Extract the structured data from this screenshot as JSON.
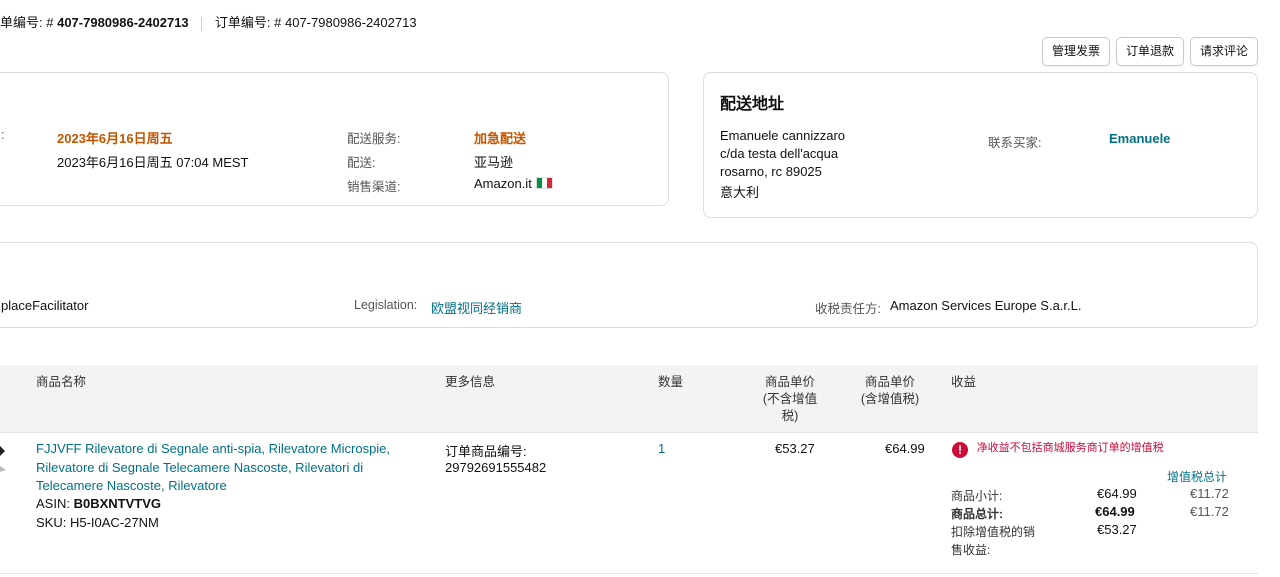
{
  "header": {
    "order_label_1": "单编号: #",
    "order_number_1": "407-7980986-2402713",
    "order_label_2": "订单编号: # 407-7980986-2402713"
  },
  "actions": {
    "manage_invoice": "管理发票",
    "refund": "订单退款",
    "request_review": "请求评论"
  },
  "order_card": {
    "colon": ":",
    "ship_by_date": "2023年6月16日周五",
    "purchase_date": "2023年6月16日周五 07:04 MEST",
    "shipping_service_label": "配送服务:",
    "shipping_service_value": "加急配送",
    "fulfillment_label": "配送:",
    "fulfillment_value": "亚马逊",
    "sales_channel_label": "销售渠道:",
    "sales_channel_value": "Amazon.it"
  },
  "shipping_card": {
    "title": "配送地址",
    "address_lines": [
      "Emanuele cannizzaro",
      "c/da testa dell'acqua",
      "rosarno, rc 89025",
      "意大利"
    ],
    "contact_label": "联系买家:",
    "contact_name": "Emanuele"
  },
  "tax_card": {
    "facilitator": "placeFacilitator",
    "legislation_label": "Legislation:",
    "legislation_value": "欧盟视同经销商",
    "tax_party_label": "收税责任方:",
    "tax_party_value": "Amazon Services Europe S.a.r.L."
  },
  "table": {
    "headers": {
      "product_name": "商品名称",
      "more_info": "更多信息",
      "quantity": "数量",
      "price_ex_vat_line1": "商品单价",
      "price_ex_vat_line2": "(不含增值",
      "price_ex_vat_line3": "税)",
      "price_inc_vat_line1": "商品单价",
      "price_inc_vat_line2": "(含增值税)",
      "proceeds": "收益"
    },
    "row": {
      "title": "FJJVFF Rilevatore di Segnale anti-spia, Rilevatore Microspie, Rilevatore di Segnale Telecamere Nascoste, Rilevatori di Telecamere Nascoste, Rilevatore",
      "asin_label": "ASIN:",
      "asin": "B0BXNTVTVG",
      "sku_label": "SKU:",
      "sku": "H5-I0AC-27NM",
      "order_item_label": "订单商品编号:",
      "order_item_id": "29792691555482",
      "quantity": "1",
      "price_ex_vat": "€53.27",
      "price_inc_vat": "€64.99",
      "warning": "净收益不包括商城服务商订单的增值税",
      "vat_total_label": "增值税总计",
      "subtotal_label": "商品小计:",
      "subtotal_value": "€64.99",
      "subtotal_vat": "€11.72",
      "total_label": "商品总计:",
      "total_value": "€64.99",
      "total_vat": "€11.72",
      "net_label_1": "扣除增值税的销",
      "net_label_2": "售收益:",
      "net_value": "€53.27"
    }
  },
  "colors": {
    "link": "#007185",
    "orange": "#c45500",
    "warning": "#cc0c39",
    "flag": [
      "#009246",
      "#ffffff",
      "#ce2b37"
    ]
  }
}
